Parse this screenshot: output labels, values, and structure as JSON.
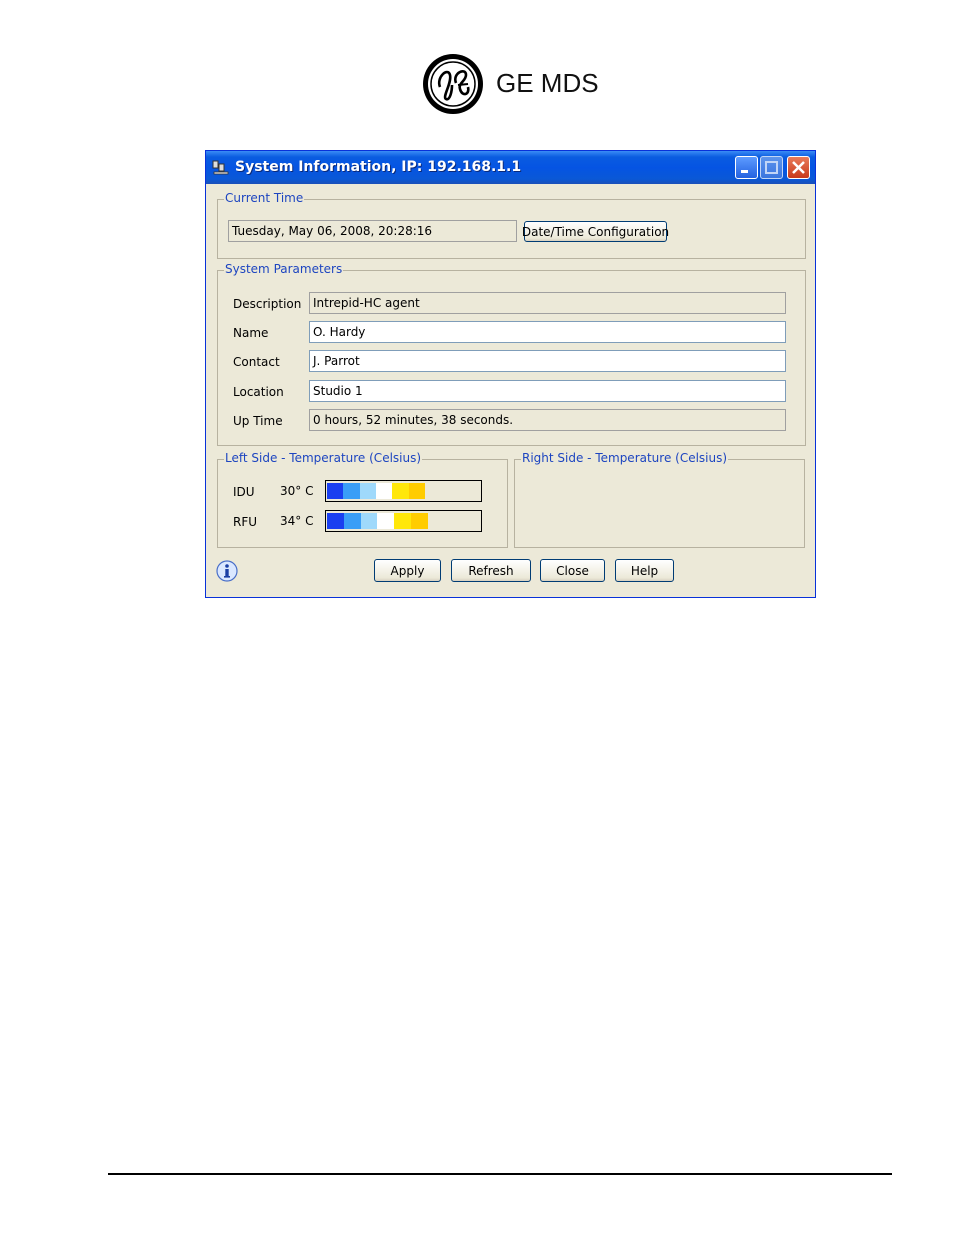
{
  "header": {
    "brand": "GE MDS",
    "logo_icon": "ge-monogram-logo"
  },
  "window": {
    "title": "System Information, IP: 192.168.1.1",
    "title_icon": "network-computer-icon",
    "controls": {
      "minimize": "minimize-icon",
      "maximize": "maximize-icon",
      "close": "close-icon"
    }
  },
  "current_time": {
    "group_label": "Current Time",
    "value": "Tuesday, May 06, 2008, 20:28:16",
    "config_button": "Date/Time Configuration"
  },
  "system_parameters": {
    "group_label": "System Parameters",
    "fields": [
      {
        "label": "Description",
        "value": "Intrepid-HC agent",
        "editable": false
      },
      {
        "label": "Name",
        "value": "O. Hardy",
        "editable": true
      },
      {
        "label": "Contact",
        "value": "J. Parrot",
        "editable": true
      },
      {
        "label": "Location",
        "value": "Studio 1",
        "editable": true
      },
      {
        "label": "Up Time",
        "value": "0 hours, 52  minutes, 38 seconds.",
        "editable": false
      }
    ]
  },
  "left_temperature": {
    "group_label": "Left Side - Temperature (Celsius)",
    "rows": [
      {
        "label": "IDU",
        "value": "30° C",
        "level": 0.64
      },
      {
        "label": "RFU",
        "value": "34° C",
        "level": 0.66
      }
    ],
    "scale_colors": [
      "#1a3ff0",
      "#3a9ef7",
      "#9fd9fb",
      "#ffffff",
      "#ffe70a",
      "#ffcc00"
    ]
  },
  "right_temperature": {
    "group_label": "Right Side - Temperature (Celsius)"
  },
  "buttons": {
    "apply": "Apply",
    "refresh": "Refresh",
    "close": "Close",
    "help": "Help"
  },
  "info_icon": "info-icon"
}
